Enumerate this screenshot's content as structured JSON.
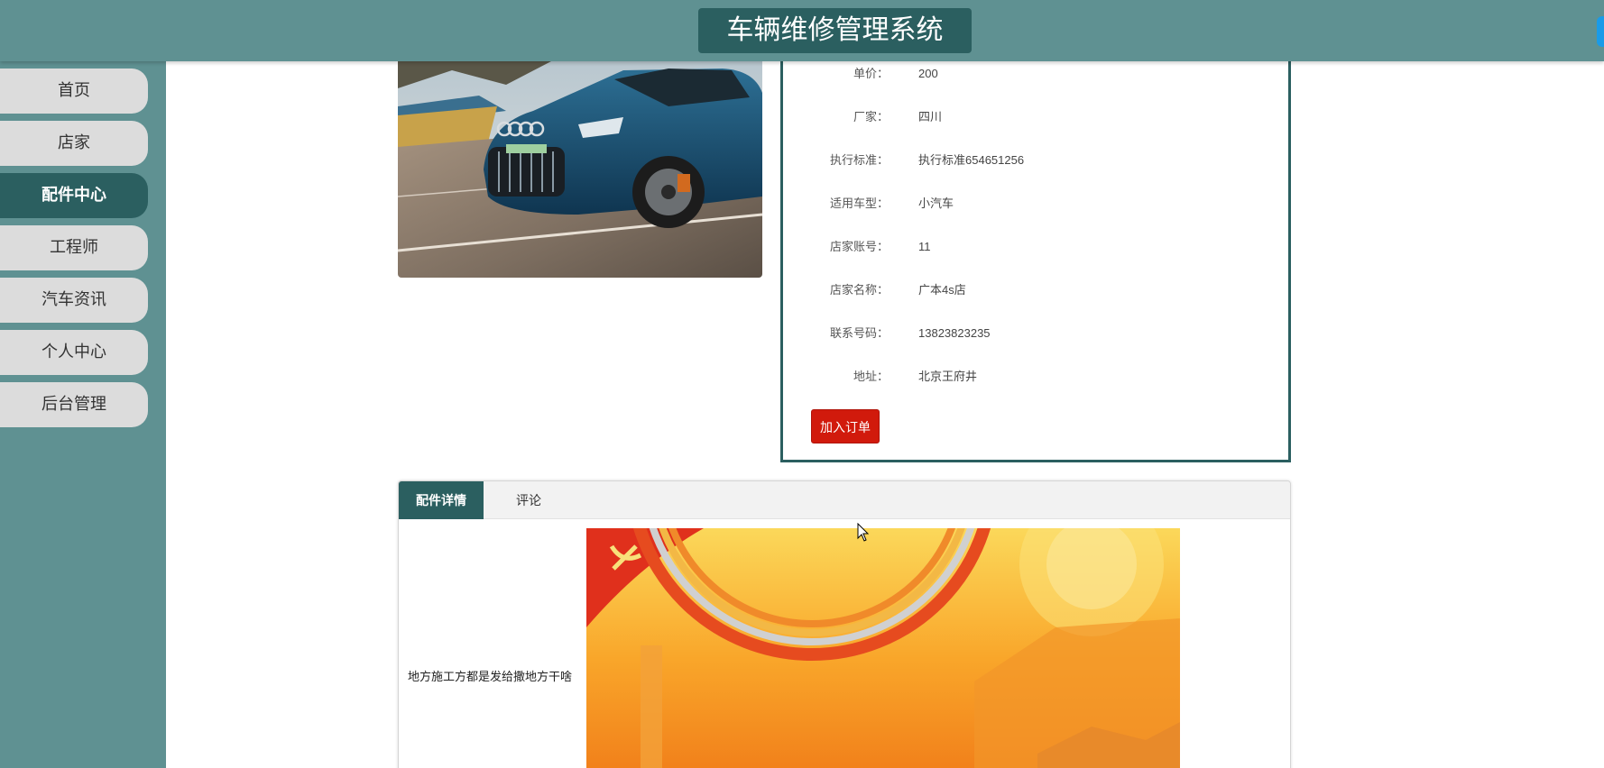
{
  "header": {
    "title": "车辆维修管理系统"
  },
  "sidebar": {
    "items": [
      {
        "label": "首页",
        "active": false
      },
      {
        "label": "店家",
        "active": false
      },
      {
        "label": "配件中心",
        "active": true
      },
      {
        "label": "工程师",
        "active": false
      },
      {
        "label": "汽车资讯",
        "active": false
      },
      {
        "label": "个人中心",
        "active": false
      },
      {
        "label": "后台管理",
        "active": false
      }
    ]
  },
  "product": {
    "fields": [
      {
        "label": "单价：",
        "value": "200"
      },
      {
        "label": "厂家：",
        "value": "四川"
      },
      {
        "label": "执行标准：",
        "value": "执行标准654651256"
      },
      {
        "label": "适用车型：",
        "value": "小汽车"
      },
      {
        "label": "店家账号：",
        "value": "11"
      },
      {
        "label": "店家名称：",
        "value": "广本4s店"
      },
      {
        "label": "联系号码：",
        "value": "13823823235"
      },
      {
        "label": "地址：",
        "value": "北京王府井"
      }
    ],
    "order_button": "加入订单"
  },
  "tabs": {
    "items": [
      "配件详情",
      "评论"
    ],
    "detail_text": "地方施工方都是发给撒地方干啥"
  },
  "colors": {
    "header_bg": "#5f9192",
    "accent_dark": "#2b5f60",
    "order_red": "#d11a0c",
    "nav_inactive": "#dcdcdc"
  }
}
